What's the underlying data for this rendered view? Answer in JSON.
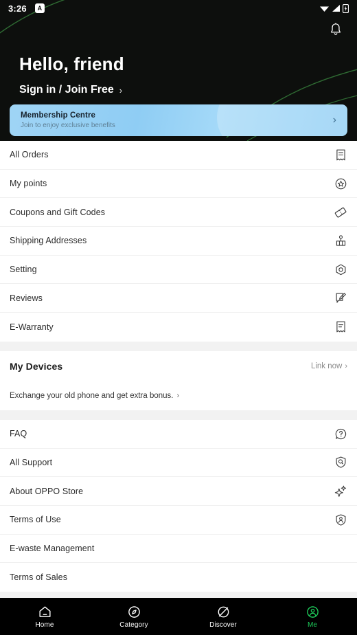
{
  "status_bar": {
    "time": "3:26",
    "badge": "A",
    "icons": [
      "wifi-icon",
      "signal-icon",
      "battery-charging-icon"
    ]
  },
  "header": {
    "notification_icon": "bell-icon",
    "greeting": "Hello, friend",
    "signin_label": "Sign in / Join Free",
    "signin_chevron": "›",
    "background_color": "#0d0f0d",
    "arc_color": "#2f6b33"
  },
  "membership": {
    "title": "Membership Centre",
    "subtitle": "Join to enjoy exclusive benefits",
    "chevron": "›",
    "accent_color": "#8fcdf4"
  },
  "account_section": {
    "items": [
      {
        "label": "All Orders",
        "icon": "receipt-icon"
      },
      {
        "label": "My points",
        "icon": "star-circle-icon"
      },
      {
        "label": "Coupons and Gift Codes",
        "icon": "coupon-icon"
      },
      {
        "label": "Shipping Addresses",
        "icon": "map-pin-icon"
      },
      {
        "label": "Setting",
        "icon": "gear-hexagon-icon"
      },
      {
        "label": "Reviews",
        "icon": "review-edit-icon"
      },
      {
        "label": "E-Warranty",
        "icon": "warranty-receipt-icon"
      }
    ]
  },
  "devices_section": {
    "title": "My Devices",
    "link_label": "Link now",
    "link_chevron": "›",
    "promo_label": "Exchange your old phone and get extra bonus.",
    "promo_chevron": "›"
  },
  "support_section": {
    "items": [
      {
        "label": "FAQ",
        "icon": "question-bubble-icon"
      },
      {
        "label": "All Support",
        "icon": "shield-search-icon"
      },
      {
        "label": "About OPPO Store",
        "icon": "sparkle-icon"
      },
      {
        "label": "Terms of Use",
        "icon": "shield-person-icon"
      },
      {
        "label": "E-waste Management",
        "icon": ""
      },
      {
        "label": "Terms of Sales",
        "icon": ""
      }
    ]
  },
  "bottom_nav": {
    "active_color": "#1ecb5a",
    "items": [
      {
        "label": "Home",
        "icon": "home-icon",
        "active": false
      },
      {
        "label": "Category",
        "icon": "compass-icon",
        "active": false
      },
      {
        "label": "Discover",
        "icon": "planet-icon",
        "active": false
      },
      {
        "label": "Me",
        "icon": "person-circle-icon",
        "active": true
      }
    ]
  }
}
